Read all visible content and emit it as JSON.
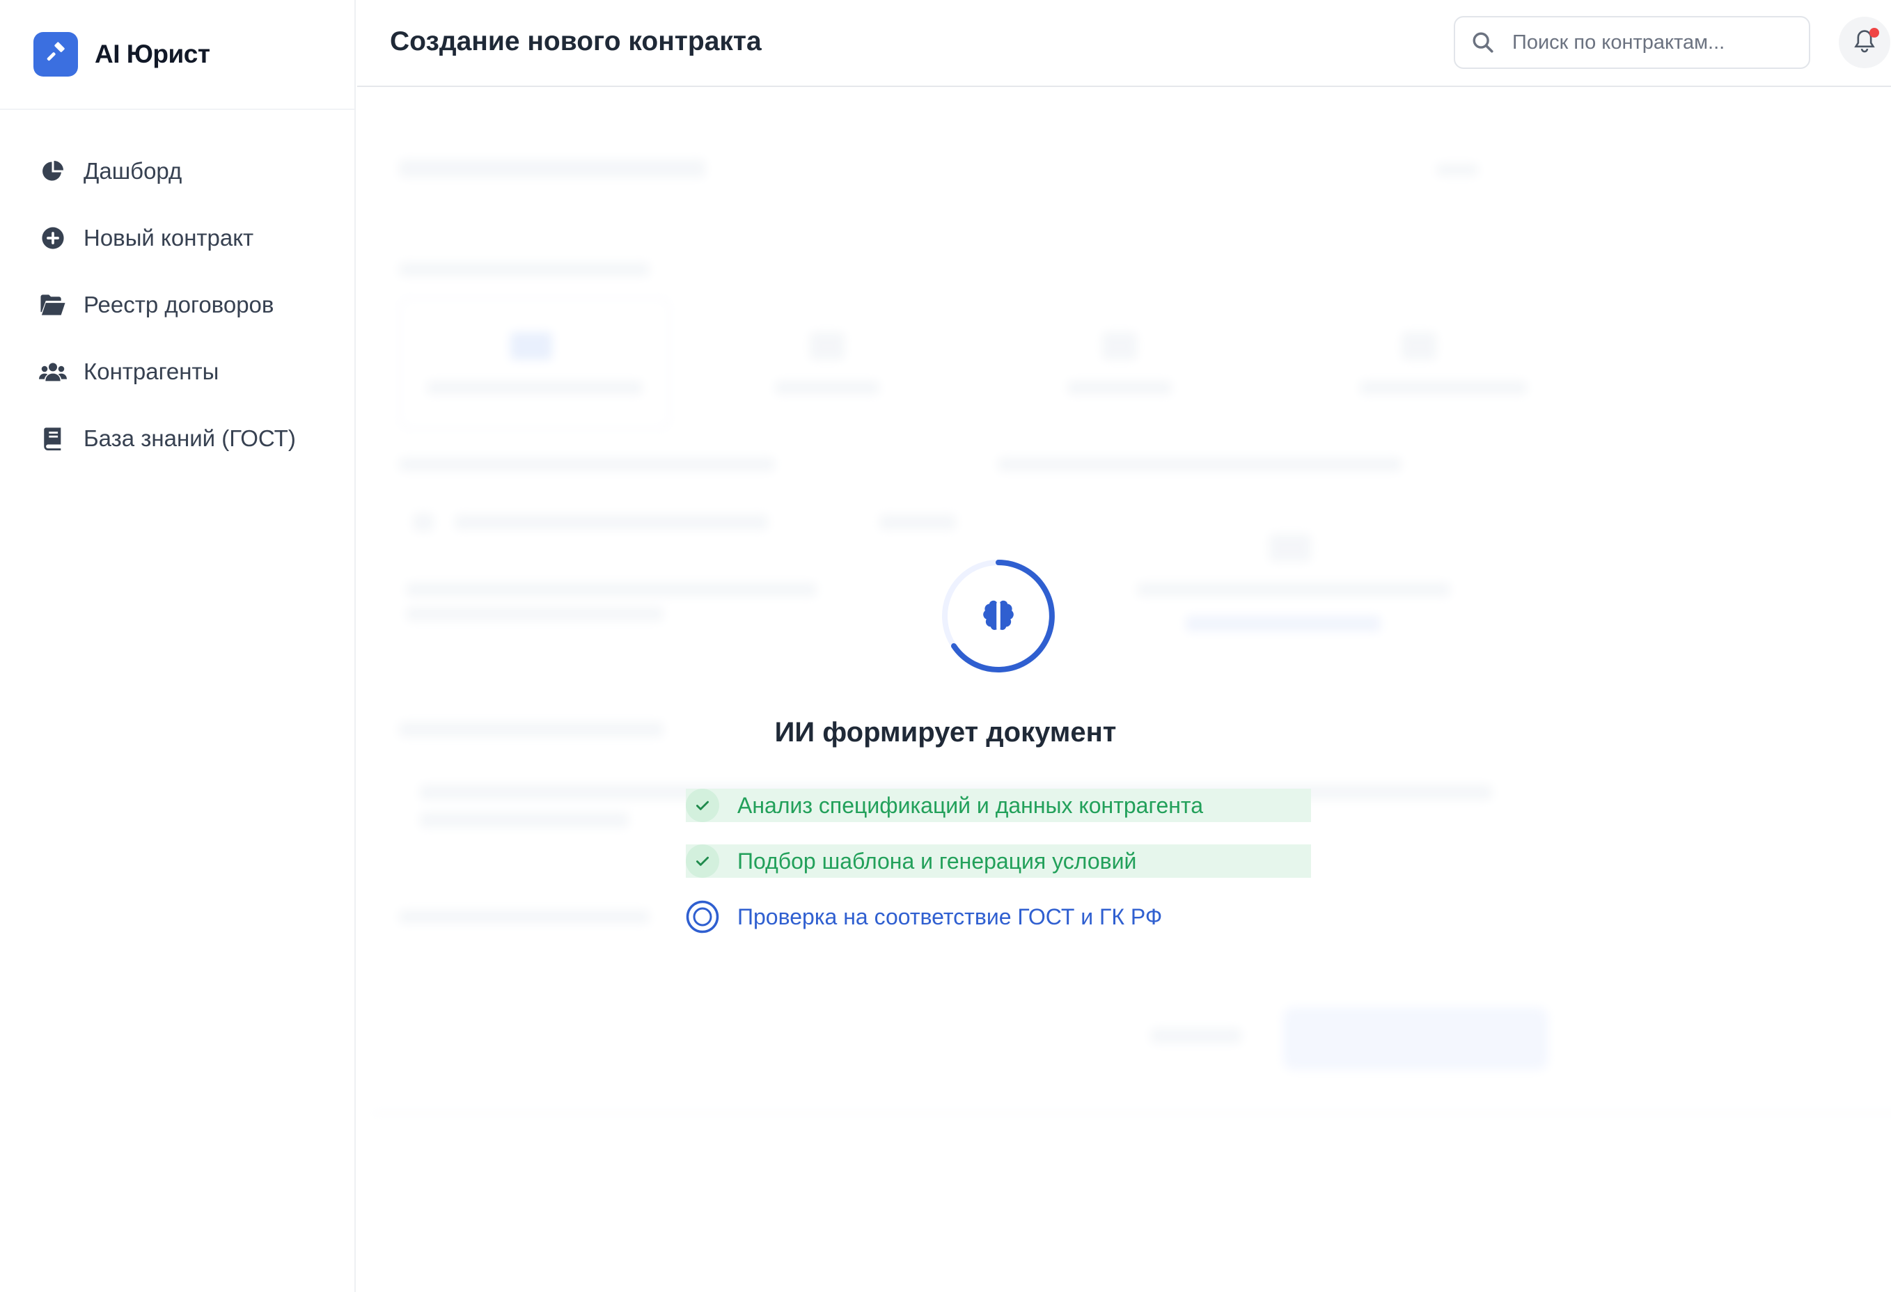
{
  "brand": {
    "name": "AI Юрист",
    "logo_icon": "gavel-icon",
    "accent": "#3b6fe0"
  },
  "sidebar": {
    "items": [
      {
        "label": "Дашборд",
        "icon": "pie-chart-icon"
      },
      {
        "label": "Новый контракт",
        "icon": "plus-circle-icon"
      },
      {
        "label": "Реестр договоров",
        "icon": "folder-open-icon"
      },
      {
        "label": "Контрагенты",
        "icon": "users-icon"
      },
      {
        "label": "База знаний (ГОСТ)",
        "icon": "book-icon"
      }
    ]
  },
  "header": {
    "title": "Создание нового контракта",
    "search_placeholder": "Поиск по контрактам...",
    "notification_badge_color": "#ef4444"
  },
  "overlay": {
    "title": "ИИ формирует документ",
    "icon": "brain-icon",
    "steps": [
      {
        "label": "Анализ спецификаций и данных контрагента",
        "status": "done"
      },
      {
        "label": "Подбор шаблона и генерация условий",
        "status": "done"
      },
      {
        "label": "Проверка на соответствие ГОСТ и ГК РФ",
        "status": "in-progress"
      }
    ],
    "colors": {
      "done": "#22a05a",
      "active": "#2f5fd0"
    }
  }
}
